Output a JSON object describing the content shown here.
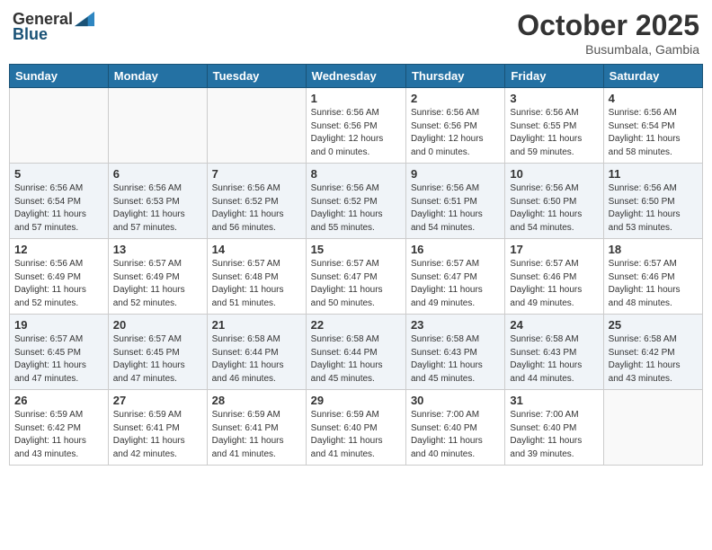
{
  "header": {
    "logo_general": "General",
    "logo_blue": "Blue",
    "month": "October 2025",
    "location": "Busumbala, Gambia"
  },
  "days_of_week": [
    "Sunday",
    "Monday",
    "Tuesday",
    "Wednesday",
    "Thursday",
    "Friday",
    "Saturday"
  ],
  "weeks": [
    [
      {
        "num": "",
        "info": ""
      },
      {
        "num": "",
        "info": ""
      },
      {
        "num": "",
        "info": ""
      },
      {
        "num": "1",
        "info": "Sunrise: 6:56 AM\nSunset: 6:56 PM\nDaylight: 12 hours\nand 0 minutes."
      },
      {
        "num": "2",
        "info": "Sunrise: 6:56 AM\nSunset: 6:56 PM\nDaylight: 12 hours\nand 0 minutes."
      },
      {
        "num": "3",
        "info": "Sunrise: 6:56 AM\nSunset: 6:55 PM\nDaylight: 11 hours\nand 59 minutes."
      },
      {
        "num": "4",
        "info": "Sunrise: 6:56 AM\nSunset: 6:54 PM\nDaylight: 11 hours\nand 58 minutes."
      }
    ],
    [
      {
        "num": "5",
        "info": "Sunrise: 6:56 AM\nSunset: 6:54 PM\nDaylight: 11 hours\nand 57 minutes."
      },
      {
        "num": "6",
        "info": "Sunrise: 6:56 AM\nSunset: 6:53 PM\nDaylight: 11 hours\nand 57 minutes."
      },
      {
        "num": "7",
        "info": "Sunrise: 6:56 AM\nSunset: 6:52 PM\nDaylight: 11 hours\nand 56 minutes."
      },
      {
        "num": "8",
        "info": "Sunrise: 6:56 AM\nSunset: 6:52 PM\nDaylight: 11 hours\nand 55 minutes."
      },
      {
        "num": "9",
        "info": "Sunrise: 6:56 AM\nSunset: 6:51 PM\nDaylight: 11 hours\nand 54 minutes."
      },
      {
        "num": "10",
        "info": "Sunrise: 6:56 AM\nSunset: 6:50 PM\nDaylight: 11 hours\nand 54 minutes."
      },
      {
        "num": "11",
        "info": "Sunrise: 6:56 AM\nSunset: 6:50 PM\nDaylight: 11 hours\nand 53 minutes."
      }
    ],
    [
      {
        "num": "12",
        "info": "Sunrise: 6:56 AM\nSunset: 6:49 PM\nDaylight: 11 hours\nand 52 minutes."
      },
      {
        "num": "13",
        "info": "Sunrise: 6:57 AM\nSunset: 6:49 PM\nDaylight: 11 hours\nand 52 minutes."
      },
      {
        "num": "14",
        "info": "Sunrise: 6:57 AM\nSunset: 6:48 PM\nDaylight: 11 hours\nand 51 minutes."
      },
      {
        "num": "15",
        "info": "Sunrise: 6:57 AM\nSunset: 6:47 PM\nDaylight: 11 hours\nand 50 minutes."
      },
      {
        "num": "16",
        "info": "Sunrise: 6:57 AM\nSunset: 6:47 PM\nDaylight: 11 hours\nand 49 minutes."
      },
      {
        "num": "17",
        "info": "Sunrise: 6:57 AM\nSunset: 6:46 PM\nDaylight: 11 hours\nand 49 minutes."
      },
      {
        "num": "18",
        "info": "Sunrise: 6:57 AM\nSunset: 6:46 PM\nDaylight: 11 hours\nand 48 minutes."
      }
    ],
    [
      {
        "num": "19",
        "info": "Sunrise: 6:57 AM\nSunset: 6:45 PM\nDaylight: 11 hours\nand 47 minutes."
      },
      {
        "num": "20",
        "info": "Sunrise: 6:57 AM\nSunset: 6:45 PM\nDaylight: 11 hours\nand 47 minutes."
      },
      {
        "num": "21",
        "info": "Sunrise: 6:58 AM\nSunset: 6:44 PM\nDaylight: 11 hours\nand 46 minutes."
      },
      {
        "num": "22",
        "info": "Sunrise: 6:58 AM\nSunset: 6:44 PM\nDaylight: 11 hours\nand 45 minutes."
      },
      {
        "num": "23",
        "info": "Sunrise: 6:58 AM\nSunset: 6:43 PM\nDaylight: 11 hours\nand 45 minutes."
      },
      {
        "num": "24",
        "info": "Sunrise: 6:58 AM\nSunset: 6:43 PM\nDaylight: 11 hours\nand 44 minutes."
      },
      {
        "num": "25",
        "info": "Sunrise: 6:58 AM\nSunset: 6:42 PM\nDaylight: 11 hours\nand 43 minutes."
      }
    ],
    [
      {
        "num": "26",
        "info": "Sunrise: 6:59 AM\nSunset: 6:42 PM\nDaylight: 11 hours\nand 43 minutes."
      },
      {
        "num": "27",
        "info": "Sunrise: 6:59 AM\nSunset: 6:41 PM\nDaylight: 11 hours\nand 42 minutes."
      },
      {
        "num": "28",
        "info": "Sunrise: 6:59 AM\nSunset: 6:41 PM\nDaylight: 11 hours\nand 41 minutes."
      },
      {
        "num": "29",
        "info": "Sunrise: 6:59 AM\nSunset: 6:40 PM\nDaylight: 11 hours\nand 41 minutes."
      },
      {
        "num": "30",
        "info": "Sunrise: 7:00 AM\nSunset: 6:40 PM\nDaylight: 11 hours\nand 40 minutes."
      },
      {
        "num": "31",
        "info": "Sunrise: 7:00 AM\nSunset: 6:40 PM\nDaylight: 11 hours\nand 39 minutes."
      },
      {
        "num": "",
        "info": ""
      }
    ]
  ]
}
